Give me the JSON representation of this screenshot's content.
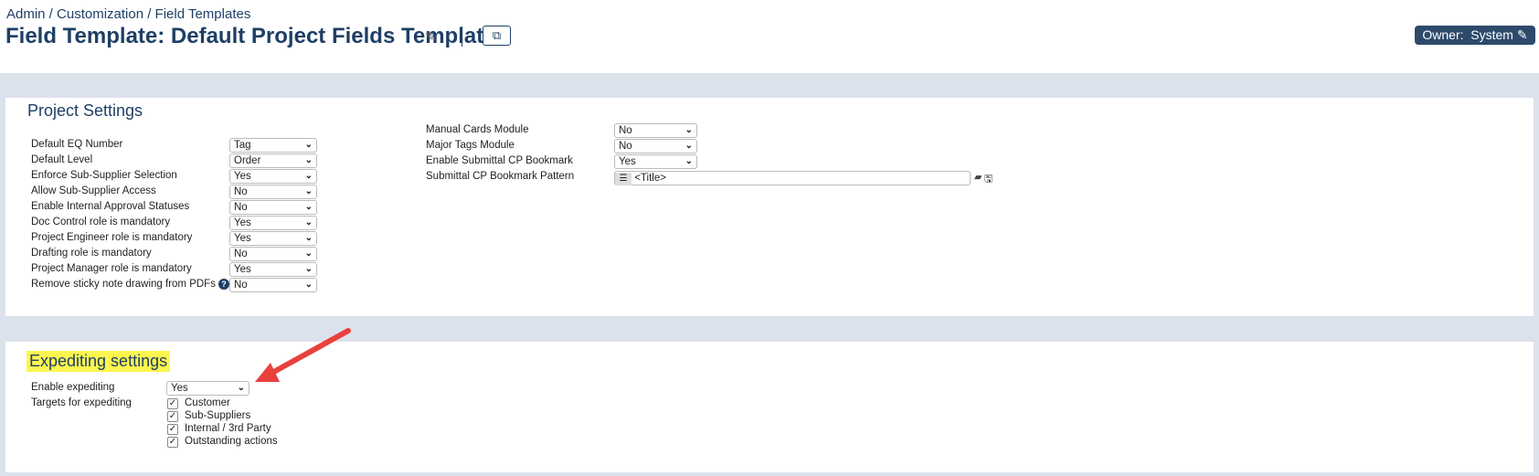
{
  "header": {
    "breadcrumb": "Admin / Customization / Field Templates",
    "title": "Field Template: Default Project Fields Template",
    "edit_icon": "pencil-icon",
    "copy_icon": "copy-icon",
    "owner_badge": "Owner:  System",
    "owner_icon": "pencil-icon"
  },
  "project_settings": {
    "title": "Project Settings",
    "left": [
      {
        "label": "Default EQ Number",
        "value": "Tag"
      },
      {
        "label": "Default Level",
        "value": "Order"
      },
      {
        "label": "Enforce Sub-Supplier Selection",
        "value": "Yes"
      },
      {
        "label": "Allow Sub-Supplier Access",
        "value": "No"
      },
      {
        "label": "Enable Internal Approval Statuses",
        "value": "No"
      },
      {
        "label": "Doc Control role is mandatory",
        "value": "Yes"
      },
      {
        "label": "Project Engineer role is mandatory",
        "value": "Yes"
      },
      {
        "label": "Drafting role is mandatory",
        "value": "No"
      },
      {
        "label": "Project Manager role is mandatory",
        "value": "Yes"
      },
      {
        "label": "Remove sticky note drawing from PDFs",
        "value": "No",
        "help": "?"
      }
    ],
    "right": [
      {
        "label": "Manual Cards Module",
        "value": "No"
      },
      {
        "label": "Major Tags Module",
        "value": "No"
      },
      {
        "label": "Enable Submittal CP Bookmark",
        "value": "Yes"
      }
    ],
    "pattern": {
      "label": "Submittal CP Bookmark Pattern",
      "value": "<Title>"
    }
  },
  "expediting": {
    "title": "Expediting settings",
    "enable_label": "Enable expediting",
    "enable_value": "Yes",
    "targets_label": "Targets for expediting",
    "targets": [
      {
        "label": "Customer",
        "checked": true
      },
      {
        "label": "Sub-Suppliers",
        "checked": true
      },
      {
        "label": "Internal / 3rd Party",
        "checked": true
      },
      {
        "label": "Outstanding actions",
        "checked": true
      }
    ]
  },
  "annotation": {
    "arrow_color": "#e8413e"
  }
}
